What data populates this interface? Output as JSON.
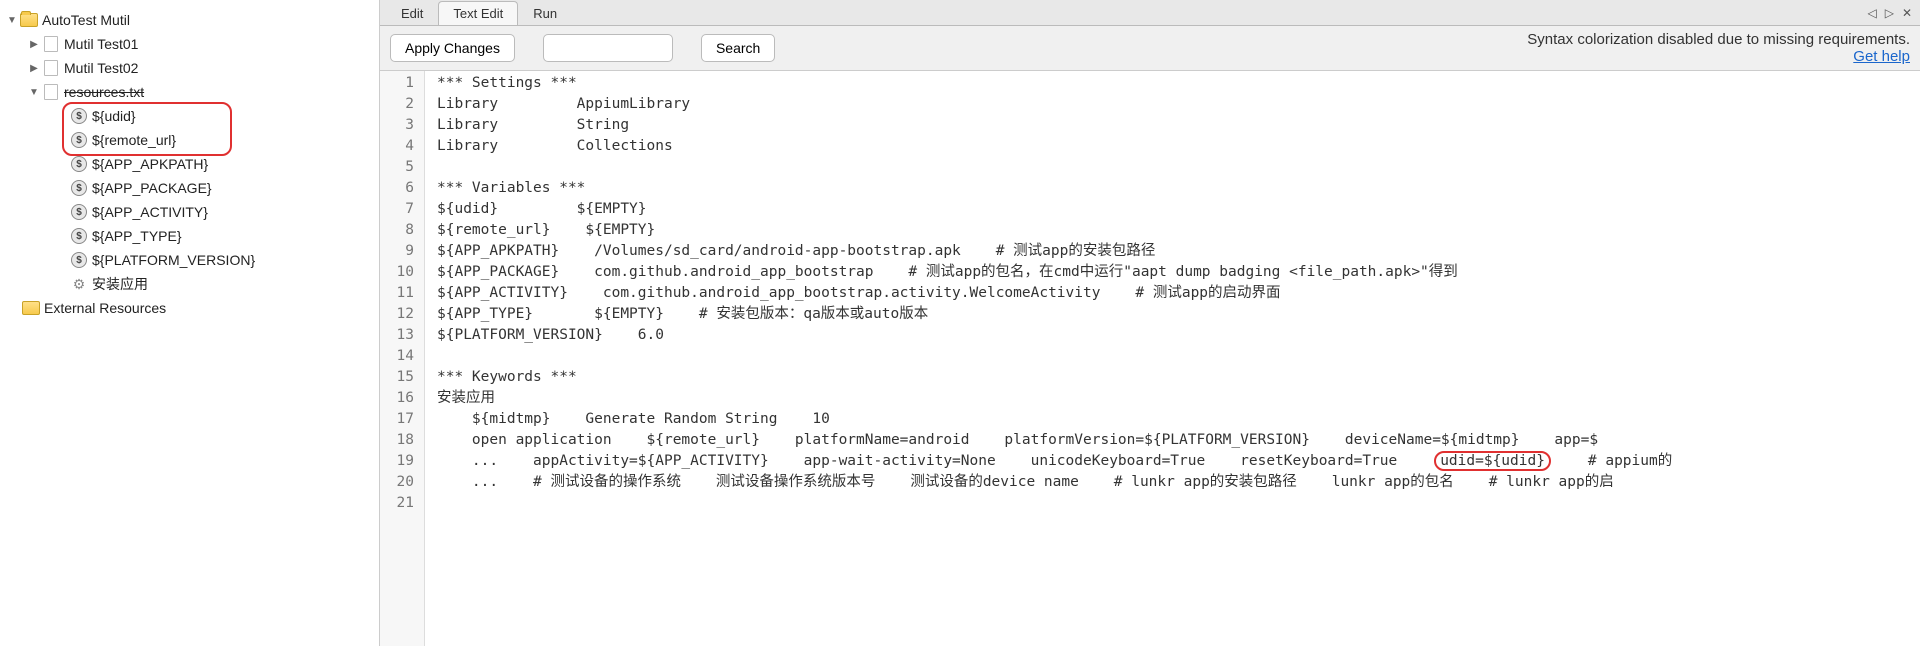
{
  "sidebar": {
    "root": "AutoTest Mutil",
    "suites": [
      "Mutil Test01",
      "Mutil Test02"
    ],
    "resource_file": "resources.txt",
    "variables": [
      "${udid}",
      "${remote_url}",
      "${APP_APKPATH}",
      "${APP_PACKAGE}",
      "${APP_ACTIVITY}",
      "${APP_TYPE}",
      "${PLATFORM_VERSION}"
    ],
    "keyword": "安装应用",
    "external": "External Resources"
  },
  "tabs": {
    "items": [
      "Edit",
      "Text Edit",
      "Run"
    ],
    "active_index": 1
  },
  "toolbar": {
    "apply": "Apply Changes",
    "search": "Search",
    "search_value": "",
    "warning": "Syntax colorization disabled due to missing requirements.",
    "help": "Get help"
  },
  "nav_controls": {
    "back": "◁",
    "forward": "▷",
    "close": "✕"
  },
  "editor": {
    "lines": [
      "*** Settings ***",
      "Library         AppiumLibrary",
      "Library         String",
      "Library         Collections",
      "",
      "*** Variables ***",
      "${udid}         ${EMPTY}",
      "${remote_url}    ${EMPTY}",
      "${APP_APKPATH}    /Volumes/sd_card/android-app-bootstrap.apk    # 测试app的安装包路径",
      "${APP_PACKAGE}    com.github.android_app_bootstrap    # 测试app的包名，在cmd中运行\"aapt dump badging <file_path.apk>\"得到",
      "${APP_ACTIVITY}    com.github.android_app_bootstrap.activity.WelcomeActivity    # 测试app的启动界面",
      "${APP_TYPE}       ${EMPTY}    # 安装包版本：qa版本或auto版本",
      "${PLATFORM_VERSION}    6.0",
      "",
      "*** Keywords ***",
      "安装应用",
      "    ${midtmp}    Generate Random String    10",
      "    open application    ${remote_url}    platformName=android    platformVersion=${PLATFORM_VERSION}    deviceName=${midtmp}    app=$",
      "    ...    appActivity=${APP_ACTIVITY}    app-wait-activity=None    unicodeKeyboard=True    resetKeyboard=True    ",
      "    ...    # 测试设备的操作系统    测试设备操作系统版本号    测试设备的device name    # lunkr app的安装包路径    lunkr app的包名    # lunkr app的启",
      ""
    ],
    "highlighted_fragment_line": 19,
    "highlighted_fragment": "udid=${udid}",
    "highlighted_tail": "    # appium的"
  }
}
